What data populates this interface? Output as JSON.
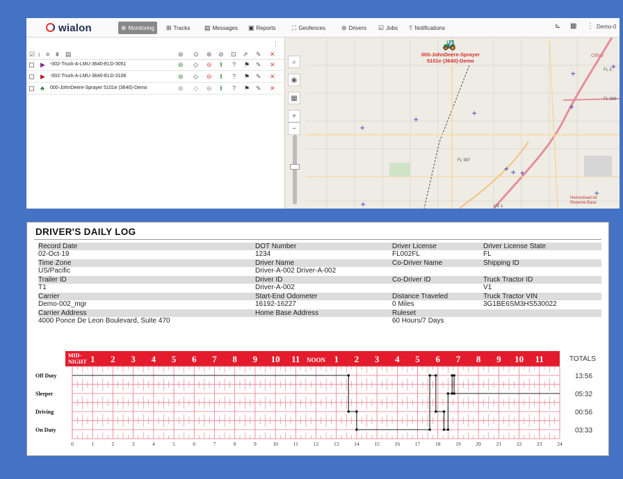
{
  "app": {
    "logo": "wialon",
    "tabs": [
      {
        "label": "Monitoring",
        "icon": "globe-icon",
        "active": true
      },
      {
        "label": "Tracks",
        "icon": "tracks-icon"
      },
      {
        "label": "Messages",
        "icon": "messages-icon"
      },
      {
        "label": "Reports",
        "icon": "reports-icon"
      },
      {
        "label": "Geofences",
        "icon": "geofence-icon"
      },
      {
        "label": "Drivers",
        "icon": "driver-icon"
      },
      {
        "label": "Jobs",
        "icon": "jobs-icon"
      },
      {
        "label": "Notifications",
        "icon": "notifications-icon"
      }
    ],
    "user_label": "Demo-0"
  },
  "units": [
    {
      "name": "-002-Truck-A-LMU-3640-ELD-3051",
      "icon_color": "#7b2a8c"
    },
    {
      "name": "-002-Truck-A-LMU-3640-ELD-3106",
      "icon_color": "#b71c1c"
    },
    {
      "name": "000-JohnDeere-Sprayer 5101e (3640)-Demo",
      "icon_color": "#2e7d32"
    }
  ],
  "map": {
    "unit_label": "000-JohnDeere-Sprayer 5101e (3640)-Demo",
    "office_label": "Office",
    "road_labels": [
      "FL 997",
      "FL 989",
      "US 1",
      "FL 5"
    ],
    "place_label": "Homestead Air Reserve Base"
  },
  "log": {
    "title": "DRIVER'S DAILY LOG",
    "rows": [
      [
        [
          "Record Date",
          "02-Oct-19"
        ],
        [
          "DOT Number",
          "1234"
        ],
        [
          "Driver License",
          "FL002FL"
        ],
        [
          "Driver License State",
          "FL"
        ]
      ],
      [
        [
          "Time Zone",
          "US/Pacific"
        ],
        [
          "Driver Name",
          "Driver-A-002 Driver-A-002"
        ],
        [
          "Co-Driver Name",
          ""
        ],
        [
          "Shipping ID",
          ""
        ]
      ],
      [
        [
          "Trailer ID",
          "T1"
        ],
        [
          "Driver ID",
          "Driver-A-002"
        ],
        [
          "Co-Driver ID",
          ""
        ],
        [
          "Truck Tractor ID",
          "V1"
        ]
      ],
      [
        [
          "Carrier",
          "Demo-002_mgr"
        ],
        [
          "Start-End Odometer",
          "16192-16227"
        ],
        [
          "Distance Traveled",
          "0 Miles"
        ],
        [
          "Truck Tractor VIN",
          "3G1BE6SM3HS530022"
        ]
      ],
      [
        [
          "Carrier Address",
          "4000 Ponce De Leon Boulevard, Suite 470"
        ],
        [
          "Home Base Address",
          ""
        ],
        [
          "Ruleset",
          "60 Hours/7 Days"
        ],
        [
          "",
          ""
        ]
      ]
    ]
  },
  "chart_data": {
    "type": "line",
    "title": "",
    "header_labels": [
      "MID-NIGHT",
      "1",
      "2",
      "3",
      "4",
      "5",
      "6",
      "7",
      "8",
      "9",
      "10",
      "11",
      "NOON",
      "1",
      "2",
      "3",
      "4",
      "5",
      "6",
      "7",
      "8",
      "9",
      "10",
      "11"
    ],
    "x_ticks": [
      "0",
      "1",
      "2",
      "3",
      "4",
      "5",
      "6",
      "7",
      "8",
      "9",
      "10",
      "11",
      "12",
      "13",
      "14",
      "15",
      "16",
      "17",
      "18",
      "19",
      "20",
      "21",
      "22",
      "23",
      "24"
    ],
    "xlim": [
      0,
      24
    ],
    "statuses": [
      "Off Duty",
      "Sleeper",
      "Driving",
      "On Duty"
    ],
    "totals_label": "TOTALS",
    "totals": [
      "13:56",
      "05:32",
      "00:56",
      "03:33"
    ],
    "series": [
      {
        "points": [
          [
            0,
            "Off Duty"
          ],
          [
            13.6,
            "Off Duty"
          ],
          [
            13.6,
            "Driving"
          ],
          [
            14.0,
            "Driving"
          ],
          [
            14.0,
            "On Duty"
          ],
          [
            17.6,
            "On Duty"
          ],
          [
            17.6,
            "Off Duty"
          ],
          [
            17.9,
            "Off Duty"
          ],
          [
            17.9,
            "Driving"
          ],
          [
            18.3,
            "Driving"
          ],
          [
            18.3,
            "On Duty"
          ],
          [
            18.5,
            "On Duty"
          ],
          [
            18.5,
            "Sleeper"
          ],
          [
            18.7,
            "Sleeper"
          ],
          [
            18.7,
            "Off Duty"
          ],
          [
            18.8,
            "Off Duty"
          ],
          [
            18.8,
            "Sleeper"
          ],
          [
            24,
            "Sleeper"
          ]
        ]
      }
    ]
  },
  "colors": {
    "header_red": "#e31b2c",
    "grid_red": "#e8768a",
    "background": "#4472c4"
  }
}
